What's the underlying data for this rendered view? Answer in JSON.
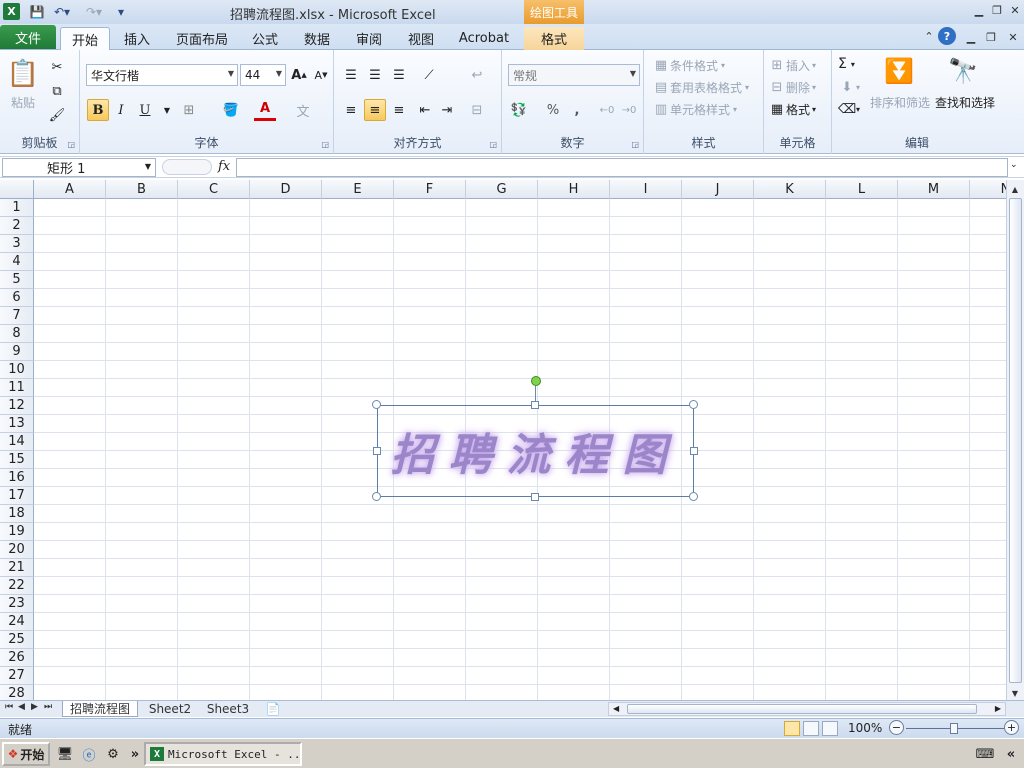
{
  "window": {
    "title": "招聘流程图.xlsx - Microsoft Excel",
    "context_tools": "绘图工具"
  },
  "tabs": {
    "file": "文件",
    "items": [
      "开始",
      "插入",
      "页面布局",
      "公式",
      "数据",
      "审阅",
      "视图",
      "Acrobat",
      "格式"
    ]
  },
  "ribbon": {
    "clipboard": {
      "label": "剪贴板",
      "paste": "粘贴"
    },
    "font": {
      "label": "字体",
      "name": "华文行楷",
      "size": "44",
      "bold": "B",
      "italic": "I",
      "underline": "U",
      "font_color": "A"
    },
    "align": {
      "label": "对齐方式"
    },
    "number": {
      "label": "数字",
      "format": "常规",
      "percent": "%",
      "comma": ","
    },
    "styles": {
      "label": "样式",
      "conditional": "条件格式",
      "table": "套用表格格式",
      "cell": "单元格样式"
    },
    "cells": {
      "label": "单元格",
      "insert": "插入",
      "delete": "删除",
      "format": "格式"
    },
    "editing": {
      "label": "编辑",
      "sum": "Σ",
      "sort": "排序和筛选",
      "find": "查找和选择"
    }
  },
  "formula_bar": {
    "name_box": "矩形 1",
    "fx": "fx",
    "formula": ""
  },
  "grid": {
    "columns": [
      "A",
      "B",
      "C",
      "D",
      "E",
      "F",
      "G",
      "H",
      "I",
      "J",
      "K",
      "L",
      "M",
      "N"
    ],
    "rows": [
      "1",
      "2",
      "3",
      "4",
      "5",
      "6",
      "7",
      "8",
      "9",
      "10",
      "11",
      "12",
      "13",
      "14",
      "15",
      "16",
      "17",
      "18",
      "19",
      "20",
      "21",
      "22",
      "23",
      "24",
      "25",
      "26",
      "27",
      "28"
    ]
  },
  "shape": {
    "text": "招聘流程图",
    "text_color": "#9b86c9"
  },
  "sheets": [
    "招聘流程图",
    "Sheet2",
    "Sheet3"
  ],
  "status": {
    "ready": "就绪",
    "zoom": "100%",
    "zoom_minus": "−",
    "zoom_plus": "+"
  },
  "taskbar": {
    "start": "开始",
    "overflow": "»",
    "task_excel": "Microsoft Excel - ...",
    "tray_overflow": "«"
  }
}
